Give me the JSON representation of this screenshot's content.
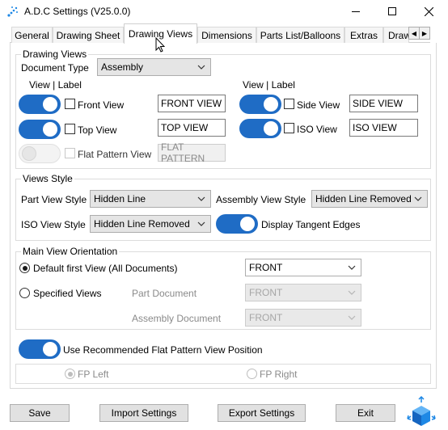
{
  "window": {
    "title": "A.D.C Settings (V25.0.0)",
    "minimize_icon": "minimize-icon",
    "maximize_icon": "maximize-icon",
    "close_icon": "close-icon"
  },
  "tabs": [
    {
      "label": "General"
    },
    {
      "label": "Drawing Sheet"
    },
    {
      "label": "Drawing Views",
      "active": true
    },
    {
      "label": "Dimensions"
    },
    {
      "label": "Parts List/Balloons"
    },
    {
      "label": "Extras"
    },
    {
      "label": "Draw"
    }
  ],
  "drawing_views": {
    "group_title": "Drawing Views",
    "doc_type_label": "Document Type",
    "doc_type_value": "Assembly",
    "view_label_header_left": "View | Label",
    "view_label_header_right": "View | Label",
    "front": {
      "label": "Front View",
      "toggle_on": true,
      "checked": false,
      "text": "FRONT VIEW"
    },
    "top": {
      "label": "Top View",
      "toggle_on": true,
      "checked": false,
      "text": "TOP VIEW"
    },
    "flat": {
      "label": "Flat Pattern View",
      "toggle_on": false,
      "checked": false,
      "text": "FLAT PATTERN",
      "disabled": true
    },
    "side": {
      "label": "Side View",
      "toggle_on": true,
      "checked": false,
      "text": "SIDE VIEW"
    },
    "iso": {
      "label": "ISO View",
      "toggle_on": true,
      "checked": false,
      "text": "ISO VIEW"
    }
  },
  "views_style": {
    "group_title": "Views Style",
    "part_label": "Part View Style",
    "part_value": "Hidden Line",
    "assembly_label": "Assembly View Style",
    "assembly_value": "Hidden Line Removed",
    "iso_label": "ISO View Style",
    "iso_value": "Hidden Line Removed",
    "tangent_label": "Display Tangent Edges",
    "tangent_on": true
  },
  "orientation": {
    "group_title": "Main View Orientation",
    "default_label": "Default first View (All Documents)",
    "default_value": "FRONT",
    "specified_label": "Specified Views",
    "part_doc_label": "Part Document",
    "part_doc_value": "FRONT",
    "assembly_doc_label": "Assembly Document",
    "assembly_doc_value": "FRONT",
    "selected": "default"
  },
  "flat_pattern": {
    "toggle_label": "Use Recommended Flat Pattern View Position",
    "toggle_on": true,
    "fp_left_label": "FP Left",
    "fp_right_label": "FP Right",
    "selected": "left"
  },
  "buttons": {
    "save": "Save",
    "import": "Import Settings",
    "export": "Export Settings",
    "exit": "Exit"
  },
  "colors": {
    "accent": "#1f6cc5",
    "logo_blue": "#1e88e5"
  }
}
